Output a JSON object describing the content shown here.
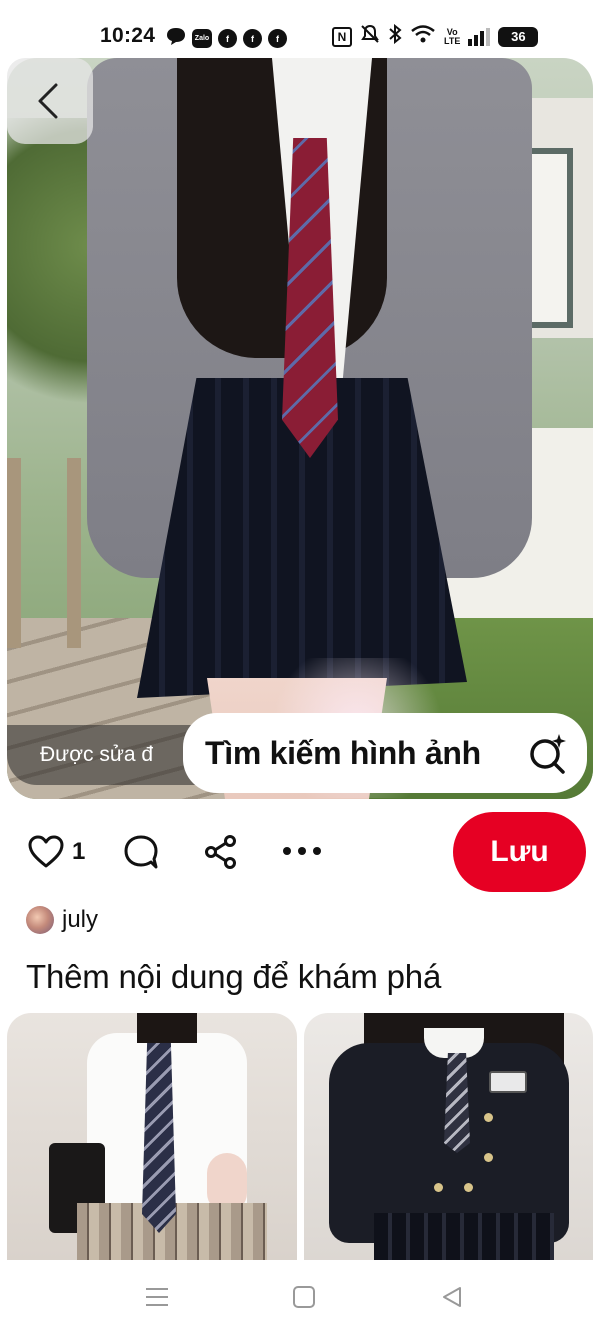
{
  "status_bar": {
    "time": "10:24",
    "left_icons": [
      "chat-bubble-icon",
      "zalo-icon",
      "facebook-icon",
      "facebook-icon",
      "facebook-icon"
    ],
    "zalo_label": "Zalo",
    "volte_label": "Vo\nLTE",
    "battery_level": "36",
    "right_icons": [
      "nfc-icon",
      "mute-icon",
      "bluetooth-icon",
      "wifi-icon",
      "volte-icon",
      "signal-icon",
      "battery-icon"
    ]
  },
  "pin": {
    "edited_label": "Được sửa đ",
    "visual_search_label": "Tìm kiếm hình ảnh",
    "like_count": "1",
    "save_label": "Lưu",
    "author_name": "july"
  },
  "more_section": {
    "title": "Thêm nội dung để khám phá"
  },
  "colors": {
    "accent": "#e60023",
    "text": "#111111",
    "background": "#ffffff"
  },
  "nav_bar": {
    "icons": [
      "menu-icon",
      "home-square-icon",
      "back-triangle-icon"
    ]
  }
}
